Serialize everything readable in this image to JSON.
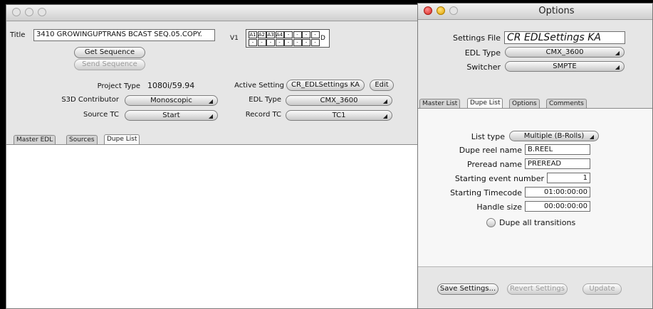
{
  "main": {
    "title_label": "Title",
    "title_value": "3410 GROWINGUPTRANS BCAST SEQ.05.COPY.",
    "get_sequence": "Get Sequence",
    "send_sequence": "Send Sequence",
    "track_label": "V1",
    "track_suffix": "D",
    "track_row1": [
      "A1",
      "A2",
      "A3",
      "A4",
      "-",
      "-",
      "-",
      "-"
    ],
    "track_row2": [
      "-",
      "-",
      "-",
      "-",
      "-",
      "-",
      "-",
      "-"
    ],
    "project_type_label": "Project Type",
    "project_type_value": "1080i/59.94",
    "s3d_label": "S3D Contributor",
    "s3d_value": "Monoscopic",
    "source_tc_label": "Source TC",
    "source_tc_value": "Start",
    "active_setting_label": "Active Setting",
    "active_setting_value": "CR_EDLSettings KA",
    "edit_label": "Edit",
    "edl_type_label": "EDL Type",
    "edl_type_value": "CMX_3600",
    "record_tc_label": "Record TC",
    "record_tc_value": "TC1",
    "tabs": [
      "Master EDL",
      "Sources",
      "Dupe List"
    ]
  },
  "options": {
    "window_title": "Options",
    "settings_file_label": "Settings File",
    "settings_file_value": "CR EDLSettings KA",
    "edl_type_label": "EDL Type",
    "edl_type_value": "CMX_3600",
    "switcher_label": "Switcher",
    "switcher_value": "SMPTE",
    "tabs": [
      "Master List",
      "Dupe List",
      "Options",
      "Comments"
    ],
    "list_type_label": "List type",
    "list_type_value": "Multiple (B-Rolls)",
    "dupe_reel_label": "Dupe reel name",
    "dupe_reel_value": "B.REEL",
    "preread_label": "Preread name",
    "preread_value": "PREREAD",
    "start_event_label": "Starting event number",
    "start_event_value": "1",
    "start_tc_label": "Starting Timecode",
    "start_tc_value": "01:00:00:00",
    "handle_label": "Handle size",
    "handle_value": "00:00:00:00",
    "dupe_all_label": "Dupe all transitions",
    "save_settings": "Save Settings...",
    "revert_settings": "Revert Settings",
    "update": "Update"
  }
}
